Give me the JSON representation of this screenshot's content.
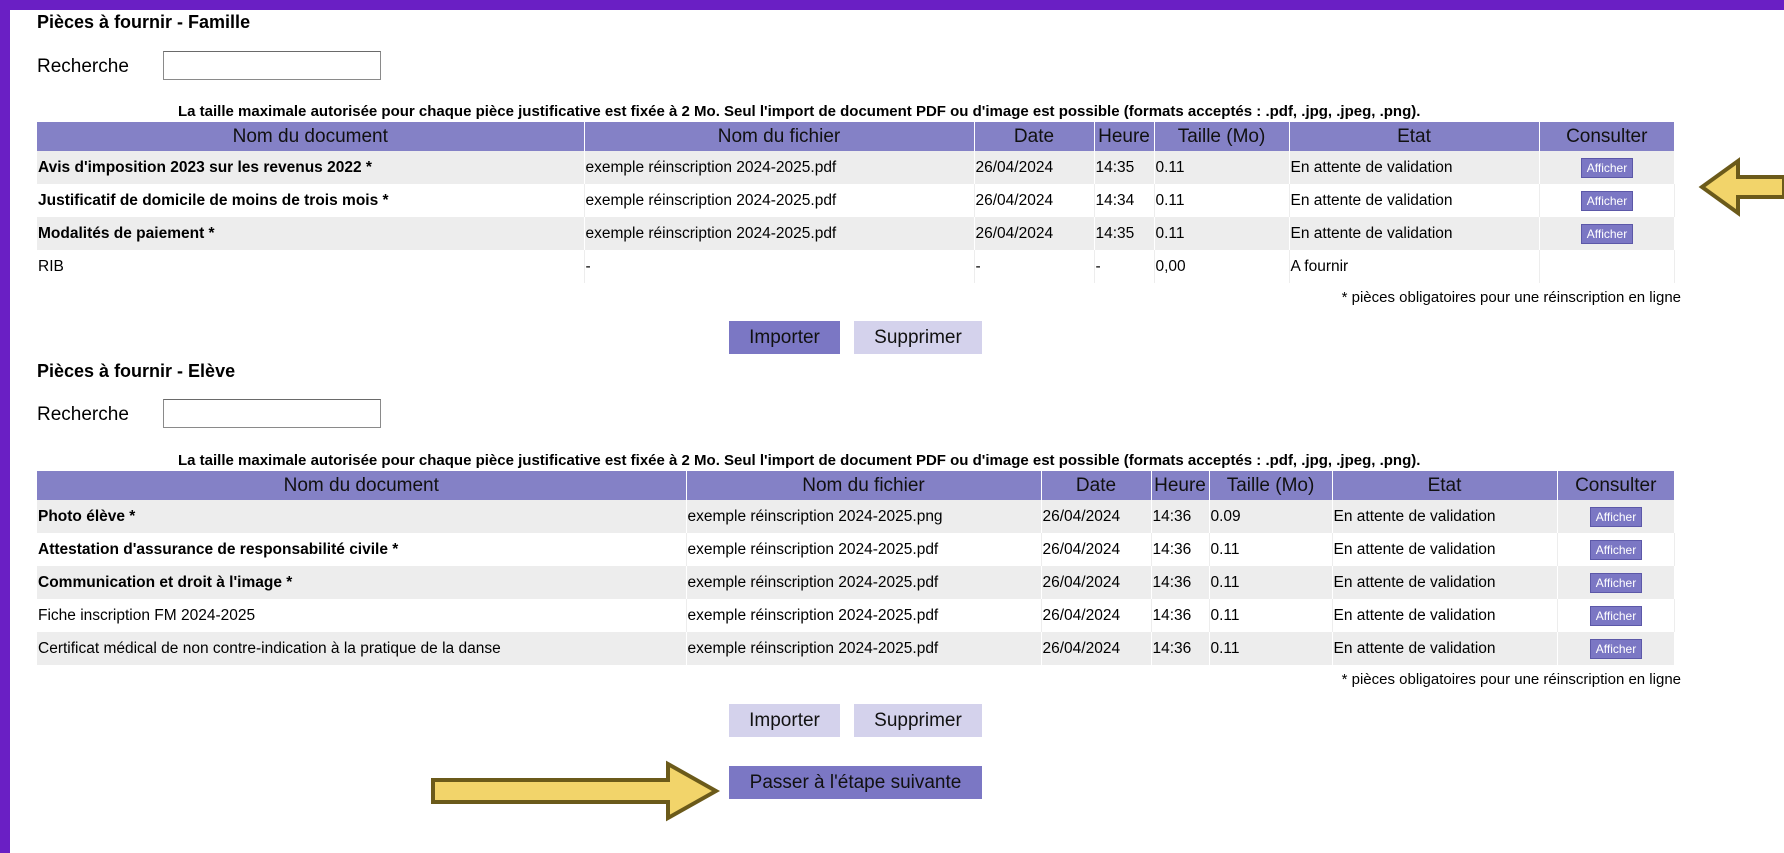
{
  "famille": {
    "title": "Pièces à fournir - Famille",
    "search_label": "Recherche",
    "search_value": "",
    "notice": "La taille maximale autorisée pour chaque pièce justificative est fixée à 2 Mo. Seul l'import de document PDF ou d'image est possible (formats acceptés : .pdf, .jpg, .jpeg, .png).",
    "columns": [
      "Nom du document",
      "Nom du fichier",
      "Date",
      "Heure",
      "Taille (Mo)",
      "Etat",
      "Consulter"
    ],
    "rows": [
      {
        "doc": "Avis d'imposition 2023 sur les revenus 2022 *",
        "file": "exemple réinscription 2024-2025.pdf",
        "date": "26/04/2024",
        "time": "14:35",
        "size": "0.11",
        "status": "En attente de validation",
        "action": "Afficher",
        "required": true
      },
      {
        "doc": "Justificatif de domicile de moins de trois mois *",
        "file": "exemple réinscription 2024-2025.pdf",
        "date": "26/04/2024",
        "time": "14:34",
        "size": "0.11",
        "status": "En attente de validation",
        "action": "Afficher",
        "required": true
      },
      {
        "doc": "Modalités de paiement *",
        "file": "exemple réinscription 2024-2025.pdf",
        "date": "26/04/2024",
        "time": "14:35",
        "size": "0.11",
        "status": "En attente de validation",
        "action": "Afficher",
        "required": true
      },
      {
        "doc": "RIB",
        "file": "-",
        "date": "-",
        "time": "-",
        "size": "0,00",
        "status": "A fournir",
        "action": "",
        "required": false
      }
    ],
    "footnote": "* pièces obligatoires pour une réinscription en ligne",
    "import_label": "Importer",
    "delete_label": "Supprimer"
  },
  "eleve": {
    "title": "Pièces à fournir - Elève",
    "search_label": "Recherche",
    "search_value": "",
    "notice": "La taille maximale autorisée pour chaque pièce justificative est fixée à 2 Mo. Seul l'import de document PDF ou d'image est possible (formats acceptés : .pdf, .jpg, .jpeg, .png).",
    "columns": [
      "Nom du document",
      "Nom du fichier",
      "Date",
      "Heure",
      "Taille (Mo)",
      "Etat",
      "Consulter"
    ],
    "rows": [
      {
        "doc": "Photo élève *",
        "file": "exemple réinscription 2024-2025.png",
        "date": "26/04/2024",
        "time": "14:36",
        "size": "0.09",
        "status": "En attente de validation",
        "action": "Afficher",
        "required": true
      },
      {
        "doc": "Attestation d'assurance de responsabilité civile *",
        "file": "exemple réinscription 2024-2025.pdf",
        "date": "26/04/2024",
        "time": "14:36",
        "size": "0.11",
        "status": "En attente de validation",
        "action": "Afficher",
        "required": true
      },
      {
        "doc": "Communication et droit à l'image *",
        "file": "exemple réinscription 2024-2025.pdf",
        "date": "26/04/2024",
        "time": "14:36",
        "size": "0.11",
        "status": "En attente de validation",
        "action": "Afficher",
        "required": true
      },
      {
        "doc": "Fiche inscription FM 2024-2025",
        "file": "exemple réinscription 2024-2025.pdf",
        "date": "26/04/2024",
        "time": "14:36",
        "size": "0.11",
        "status": "En attente de validation",
        "action": "Afficher",
        "required": false
      },
      {
        "doc": "Certificat médical de non contre-indication à la pratique de la danse",
        "file": "exemple réinscription 2024-2025.pdf",
        "date": "26/04/2024",
        "time": "14:36",
        "size": "0.11",
        "status": "En attente de validation",
        "action": "Afficher",
        "required": false
      }
    ],
    "footnote": "* pièces obligatoires pour une réinscription en ligne",
    "import_label": "Importer",
    "delete_label": "Supprimer"
  },
  "next_step_label": "Passer à l'étape suivante",
  "annotations": {
    "arrow_color": "#f2d46a",
    "arrow_border": "#6b5a1a",
    "arrows": [
      "arrow-left-icon",
      "arrow-right-icon"
    ]
  }
}
